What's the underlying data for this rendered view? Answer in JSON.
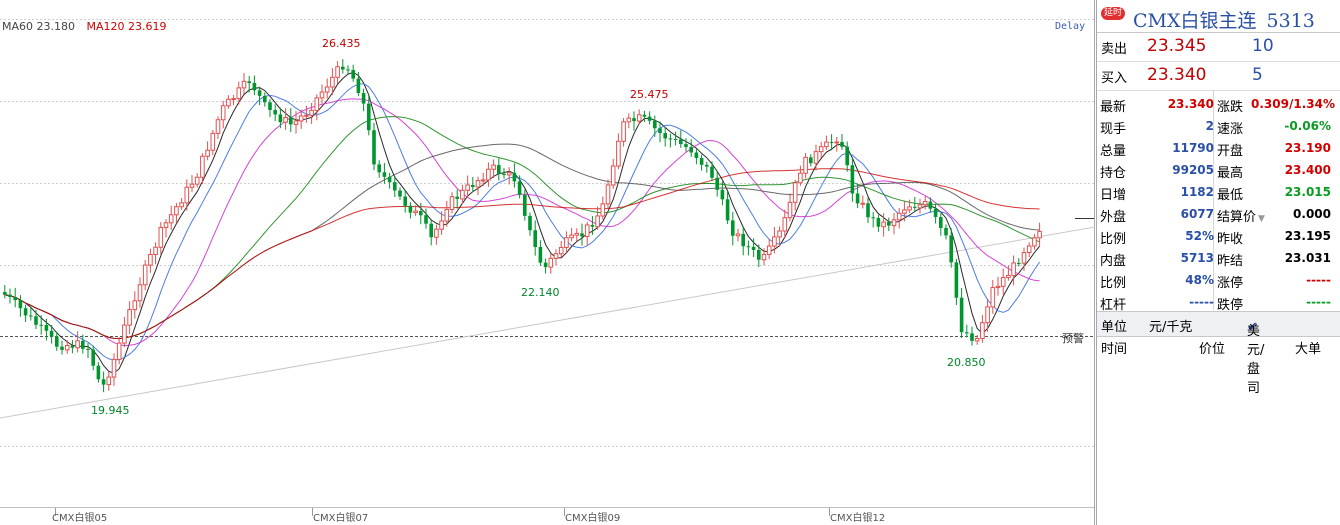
{
  "legend": {
    "ma60": "MA60 23.180",
    "ma120": "MA120 23.619",
    "ma60_color": "#444444",
    "ma120_color": "#cc0000"
  },
  "chart": {
    "delay_label": "Delay",
    "warning_label": "预警",
    "x_labels": [
      "CMX白银05",
      "CMX白银07",
      "CMX白银09",
      "CMX白银12"
    ],
    "peaks": {
      "p1": "26.435",
      "p2": "25.475",
      "t1": "19.945",
      "t2": "22.140",
      "t3": "20.850"
    },
    "colors": {
      "up": "#e05050",
      "down": "#00962e",
      "grid": "#d0d0d0"
    }
  },
  "quote": {
    "badge": "延时",
    "name": "CMX白银主连",
    "code": "5313",
    "sell_label": "卖出",
    "sell_price": "23.345",
    "sell_vol": "10",
    "buy_label": "买入",
    "buy_price": "23.340",
    "buy_vol": "5",
    "rows": [
      {
        "lk": "最新",
        "lv": "23.340",
        "rk": "涨跌",
        "rv": "0.309/1.34%"
      },
      {
        "lk": "现手",
        "lv": "2",
        "rk": "速涨",
        "rv": "-0.06%"
      },
      {
        "lk": "总量",
        "lv": "11790",
        "rk": "开盘",
        "rv": "23.190"
      },
      {
        "lk": "持仓",
        "lv": "99205",
        "rk": "最高",
        "rv": "23.400"
      },
      {
        "lk": "日增",
        "lv": "1182",
        "rk": "最低",
        "rv": "23.015"
      },
      {
        "lk": "外盘",
        "lv": "6077",
        "rk": "结算价",
        "rv": "0.000"
      },
      {
        "lk": "比例",
        "lv": "52%",
        "rk": "昨收",
        "rv": "23.195"
      },
      {
        "lk": "内盘",
        "lv": "5713",
        "rk": "昨结",
        "rv": "23.031"
      },
      {
        "lk": "比例",
        "lv": "48%",
        "rk": "涨停",
        "rv": "-----"
      },
      {
        "lk": "杠杆",
        "lv": "-----",
        "rk": "跌停",
        "rv": "-----"
      }
    ],
    "unit_label": "单位",
    "unit_value": "元/千克",
    "unit_alt": "美元/盘司",
    "col_time": "时间",
    "col_price": "价位",
    "col_vol": "大单"
  }
}
